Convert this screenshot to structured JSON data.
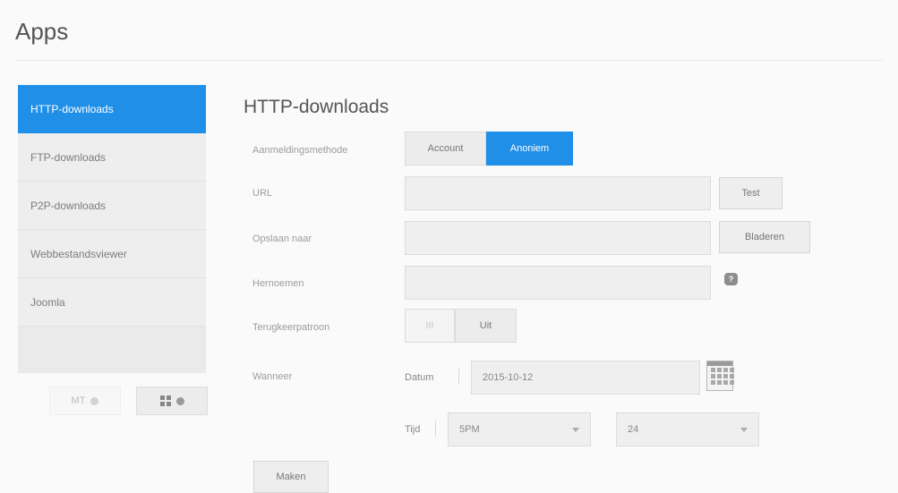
{
  "page": {
    "title": "Apps"
  },
  "sidebar": {
    "items": [
      {
        "label": "HTTP-downloads"
      },
      {
        "label": "FTP-downloads"
      },
      {
        "label": "P2P-downloads"
      },
      {
        "label": "Webbestandsviewer"
      },
      {
        "label": "Joomla"
      }
    ],
    "add_label": "MT",
    "manage_label": ""
  },
  "main": {
    "title": "HTTP-downloads",
    "login_method": {
      "label": "Aanmeldingsmethode",
      "options": [
        "Account",
        "Anoniem"
      ],
      "selected": "Anoniem"
    },
    "url": {
      "label": "URL",
      "value": "",
      "button": "Test"
    },
    "save_to": {
      "label": "Opslaan naar",
      "value": "",
      "button": "Bladeren"
    },
    "rename": {
      "label": "Hernoemen",
      "value": "",
      "help": "?"
    },
    "recurring": {
      "label": "Terugkeerpatroon",
      "on_label": "III",
      "off_label": "Uit"
    },
    "when": {
      "label": "Wanneer",
      "date_label": "Datum",
      "date_value": "2015-10-12",
      "time_label": "Tijd",
      "hour_value": "5PM",
      "minute_value": "24"
    },
    "submit_label": "Maken"
  }
}
